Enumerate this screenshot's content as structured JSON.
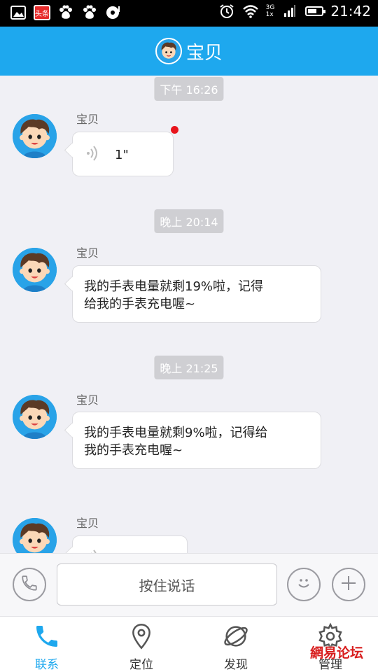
{
  "status_bar": {
    "time": "21:42",
    "network": [
      "3G",
      "1x"
    ],
    "toutiao_badge": "头条",
    "icons": [
      "image-icon",
      "toutiao-icon",
      "baidu-icon",
      "baidu-icon",
      "music-icon",
      "alarm-icon",
      "wifi-icon",
      "signal-icon",
      "battery-icon"
    ]
  },
  "header": {
    "title": "宝贝",
    "avatar_icon": "boy-avatar-icon"
  },
  "messages": [
    {
      "timestamp": "下午 16:26",
      "sender": "宝贝",
      "type": "voice",
      "duration": "1\"",
      "unread": true
    },
    {
      "timestamp": "晚上 20:14",
      "sender": "宝贝",
      "type": "text",
      "lines": [
        "我的手表电量就剩19%啦，记得",
        "给我的手表充电喔~"
      ]
    },
    {
      "timestamp": "晚上 21:25",
      "sender": "宝贝",
      "type": "text",
      "lines": [
        "我的手表电量就剩9%啦，记得给",
        "我的手表充电喔~"
      ]
    },
    {
      "sender": "宝贝",
      "type": "voice",
      "duration": "\""
    }
  ],
  "input_bar": {
    "hold_to_talk": "按住说话",
    "icons": [
      "phone-icon",
      "smiley-icon",
      "plus-icon"
    ]
  },
  "tabs": [
    {
      "label": "联系",
      "icon": "phone-icon",
      "active": true
    },
    {
      "label": "定位",
      "icon": "location-pin-icon",
      "active": false
    },
    {
      "label": "发现",
      "icon": "planet-icon",
      "active": false
    },
    {
      "label": "管理",
      "icon": "gear-icon",
      "active": false
    }
  ],
  "watermark": "網易论坛",
  "colors": {
    "accent": "#1ea8ee",
    "unread": "#e8141c",
    "background": "#f0f0f5"
  }
}
